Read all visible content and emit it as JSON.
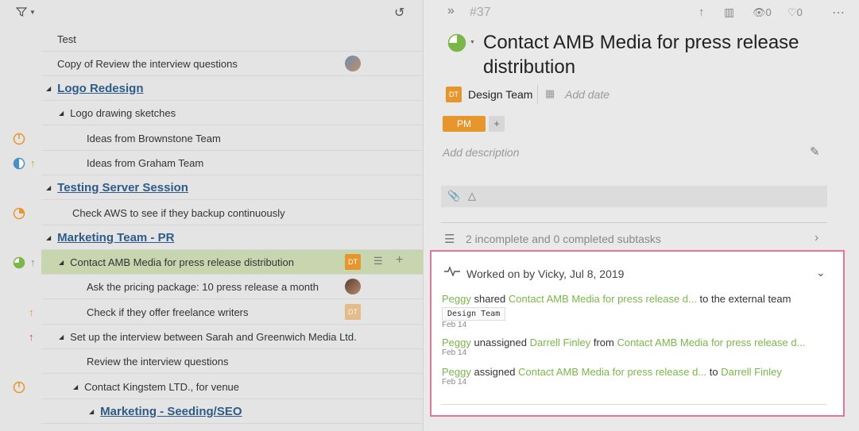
{
  "left": {
    "rows": [
      {
        "label": "Test"
      },
      {
        "label": "Copy of Review the interview questions"
      },
      {
        "label": "Logo Redesign"
      },
      {
        "label": "Logo drawing sketches"
      },
      {
        "label": "Ideas from Brownstone Team"
      },
      {
        "label": "Ideas from Graham Team"
      },
      {
        "label": "Testing Server Session"
      },
      {
        "label": "Check AWS to see if they backup continuously"
      },
      {
        "label": "Marketing Team - PR"
      },
      {
        "label": "Contact AMB Media for press release distribution"
      },
      {
        "label": "Ask the pricing package: 10 press release a month"
      },
      {
        "label": "Check if they offer freelance writers"
      },
      {
        "label": "Set up the interview between Sarah and Greenwich Media Ltd."
      },
      {
        "label": "Review the interview questions"
      },
      {
        "label": "Contact Kingstem LTD., for venue"
      },
      {
        "label": "Marketing - Seeding/SEO"
      }
    ],
    "dt_label": "DT"
  },
  "right": {
    "task_number": "#37",
    "views": "0",
    "likes": "0",
    "title": "Contact AMB Media for press release distribution",
    "team_abbr": "DT",
    "team_name": "Design Team",
    "add_date": "Add date",
    "tag": "PM",
    "add_description": "Add description",
    "subtasks": "2 incomplete and 0 completed subtasks",
    "activity": {
      "header": "Worked on by Vicky, Jul 8, 2019",
      "items": [
        {
          "user": "Peggy",
          "verb": "shared",
          "link1": "Contact AMB Media for press release d...",
          "mid": "to the external team",
          "tag": "Design Team",
          "date": "Feb 14"
        },
        {
          "user": "Peggy",
          "verb": "unassigned",
          "link1": "Darrell Finley",
          "mid": "from",
          "link2": "Contact AMB Media for press release d...",
          "date": "Feb 14"
        },
        {
          "user": "Peggy",
          "verb": "assigned",
          "link1": "Contact AMB Media for press release d...",
          "mid": "to",
          "link2": "Darrell Finley",
          "date": "Feb 14"
        }
      ]
    }
  },
  "colors": {
    "accent_orange": "#e6962c",
    "link_green": "#7ab648",
    "section_blue": "#2e5b87",
    "highlight_border": "#e8749e"
  }
}
